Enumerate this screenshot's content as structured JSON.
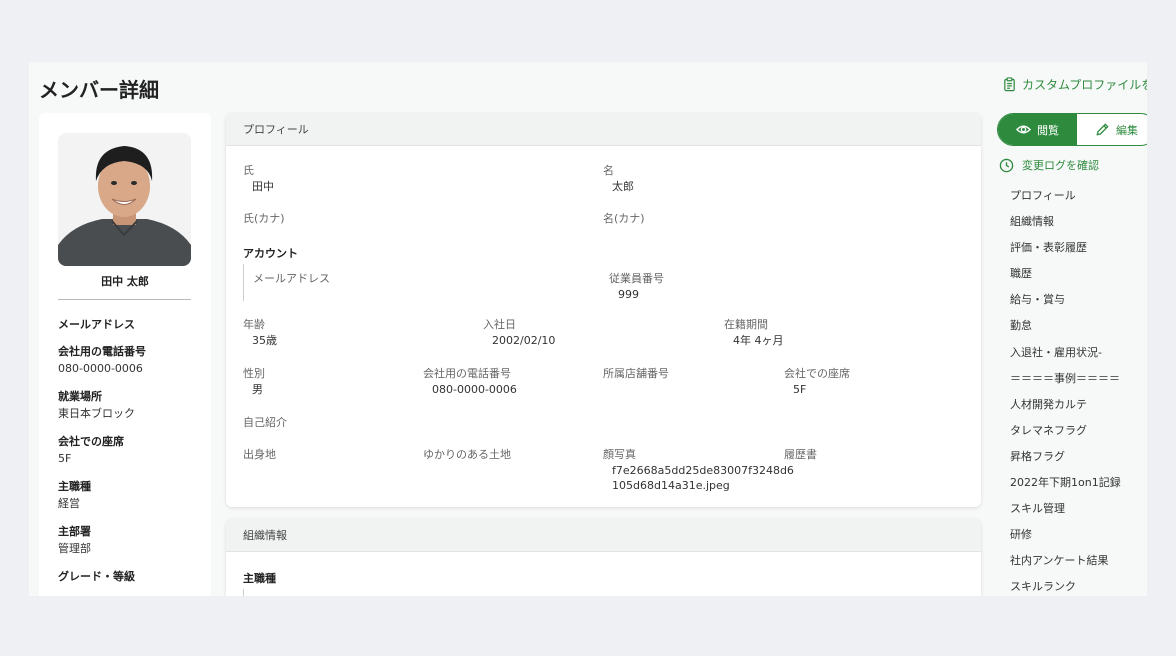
{
  "page": {
    "title": "メンバー詳細",
    "custom_profile_link": "カスタムプロファイルを",
    "accent_color": "#2e8b3e"
  },
  "member": {
    "name": "田中 太郎",
    "avatar_icon": "person-photo"
  },
  "left_fields": [
    {
      "label": "メールアドレス",
      "value": ""
    },
    {
      "label": "会社用の電話番号",
      "value": "080-0000-0006"
    },
    {
      "label": "就業場所",
      "value": "東日本ブロック"
    },
    {
      "label": "会社での座席",
      "value": "5F"
    },
    {
      "label": "主職種",
      "value": "経営"
    },
    {
      "label": "主部署",
      "value": "管理部"
    },
    {
      "label": "グレード・等級",
      "value": ""
    }
  ],
  "profile_card": {
    "header": "プロフィール",
    "last_name_label": "氏",
    "last_name": "田中",
    "first_name_label": "名",
    "first_name": "太郎",
    "last_name_kana_label": "氏(カナ)",
    "first_name_kana_label": "名(カナ)",
    "account_title": "アカウント",
    "email_label": "メールアドレス",
    "employee_no_label": "従業員番号",
    "employee_no": "999",
    "age_label": "年齢",
    "age": "35歳",
    "join_date_label": "入社日",
    "join_date": "2002/02/10",
    "tenure_label": "在籍期間",
    "tenure": "4年 4ヶ月",
    "gender_label": "性別",
    "gender": "男",
    "company_phone_label": "会社用の電話番号",
    "company_phone": "080-0000-0006",
    "store_no_label": "所属店舗番号",
    "seat_label": "会社での座席",
    "seat": "5F",
    "self_intro_label": "自己紹介",
    "birthplace_label": "出身地",
    "related_place_label": "ゆかりのある土地",
    "photo_label": "顔写真",
    "photo_file_line1": "f7e2668a5dd25de83007f3248d6",
    "photo_file_line2": "105d68d14a31e.jpeg",
    "resume_label": "履歴書"
  },
  "org_card": {
    "header": "組織情報",
    "main_job_title": "主職種"
  },
  "right_panel": {
    "view_label": "閲覧",
    "edit_label": "編集",
    "changelog_label": "変更ログを確認",
    "nav": [
      "プロフィール",
      "組織情報",
      "評価・表彰履歴",
      "職歴",
      "給与・賞与",
      "勤怠",
      "入退社・雇用状況-",
      "＝＝＝＝事例＝＝＝＝",
      "人材開発カルテ",
      "タレマネフラグ",
      "昇格フラグ",
      "2022年下期1on1記録",
      "スキル管理",
      "研修",
      "社内アンケート結果",
      "スキルランク"
    ]
  }
}
